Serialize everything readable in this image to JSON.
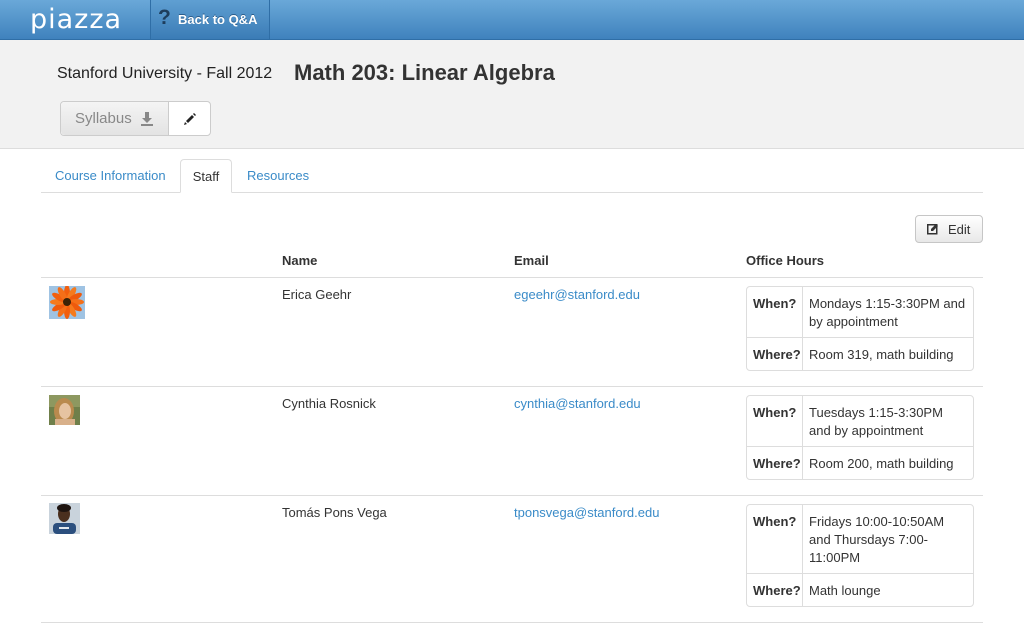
{
  "app": {
    "logo": "piazza",
    "back_label": "Back to Q&A"
  },
  "course": {
    "school": "Stanford University - Fall 2012",
    "title": "Math 203: Linear Algebra",
    "syllabus_label": "Syllabus"
  },
  "tabs": [
    {
      "label": "Course Information",
      "active": false
    },
    {
      "label": "Staff",
      "active": true
    },
    {
      "label": "Resources",
      "active": false
    }
  ],
  "edit_label": "Edit",
  "table": {
    "headers": {
      "name": "Name",
      "email": "Email",
      "office_hours": "Office Hours"
    },
    "oh_keys": {
      "when": "When?",
      "where": "Where?"
    },
    "rows": [
      {
        "name": "Erica Geehr",
        "email": "egeehr@stanford.edu",
        "when": "Mondays 1:15-3:30PM and by appointment",
        "where": "Room 319, math building",
        "avatar": "flower-avatar"
      },
      {
        "name": "Cynthia Rosnick",
        "email": "cynthia@stanford.edu",
        "when": "Tuesdays 1:15-3:30PM and by appointment",
        "where": "Room 200, math building",
        "avatar": "person-avatar"
      },
      {
        "name": "Tomás Pons Vega",
        "email": "tponsvega@stanford.edu",
        "when": "Fridays 10:00-10:50AM and Thursdays 7:00-11:00PM",
        "where": "Math lounge",
        "avatar": "person-avatar"
      }
    ]
  },
  "colors": {
    "topbar": "#4a8dc6",
    "link": "#3a8bc8",
    "header_bg": "#f2f2f2"
  }
}
